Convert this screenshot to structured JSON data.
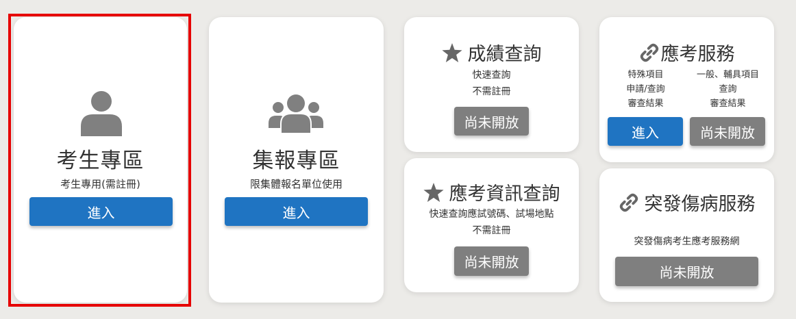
{
  "cards": {
    "examinee": {
      "title": "考生專區",
      "subtitle": "考生專用(需註冊)",
      "button": "進入",
      "icon": "user-icon"
    },
    "group": {
      "title": "集報專區",
      "subtitle": "限集體報名單位使用",
      "button": "進入",
      "icon": "users-icon"
    },
    "score": {
      "title": "成績查詢",
      "lines": [
        "快速查詢",
        "不需註冊"
      ],
      "button": "尚未開放",
      "icon": "star-icon"
    },
    "exam_info": {
      "title": "應考資訊查詢",
      "lines": [
        "快速查詢應試號碼、試場地點",
        "不需註冊"
      ],
      "button": "尚未開放",
      "icon": "star-icon"
    },
    "service": {
      "title": "應考服務",
      "left_lines": [
        "特殊項目",
        "申請/查詢",
        "審查結果"
      ],
      "right_lines": [
        "一般、輔具項目",
        "查詢",
        "審查結果"
      ],
      "left_button": "進入",
      "right_button": "尚未開放",
      "icon": "link-icon"
    },
    "sudden": {
      "title": "突發傷病服務",
      "subtitle": "突發傷病考生應考服務網",
      "button": "尚未開放",
      "icon": "link-icon"
    }
  },
  "colors": {
    "primary": "#1f74c2",
    "disabled": "#7f7f7f",
    "highlight": "#e60000"
  }
}
